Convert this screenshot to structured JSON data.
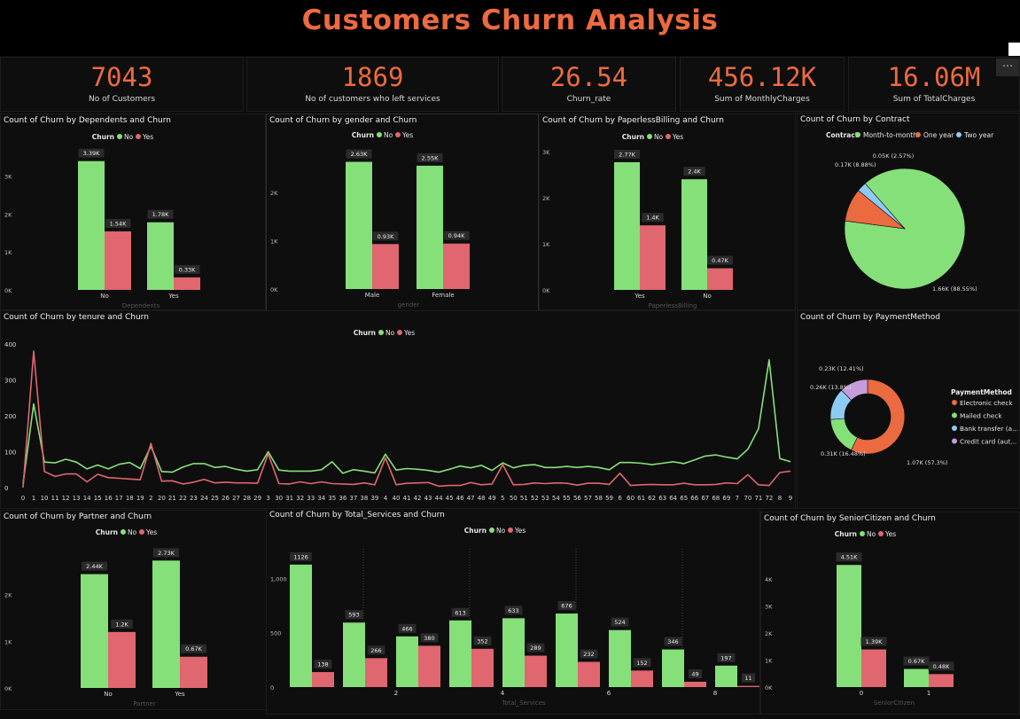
{
  "title": "Customers Churn Analysis",
  "colors": {
    "no": "#85e07a",
    "yes": "#e0666f",
    "accent": "#ec6a40",
    "one_year": "#ec6a40",
    "two_year": "#8ecbf3",
    "credit": "#c79cdb"
  },
  "kpis": [
    {
      "value": "7043",
      "label": "No of Customers"
    },
    {
      "value": "1869",
      "label": "No of customers who left services"
    },
    {
      "value": "26.54",
      "label": "Churn_rate"
    },
    {
      "value": "456.12K",
      "label": "Sum of MonthlyCharges"
    },
    {
      "value": "16.06M",
      "label": "Sum of TotalCharges"
    }
  ],
  "more_label": "⋯",
  "legend": {
    "title": "Churn",
    "no": "No",
    "yes": "Yes"
  },
  "chart_data": [
    {
      "id": "dependents",
      "type": "bar",
      "title": "Count of Churn by Dependents and Churn",
      "xlabel": "Dependents",
      "categories": [
        "No",
        "Yes"
      ],
      "series": [
        {
          "name": "No",
          "values": [
            3390,
            1780
          ],
          "labels": [
            "3.39K",
            "1.78K"
          ]
        },
        {
          "name": "Yes",
          "values": [
            1540,
            330
          ],
          "labels": [
            "1.54K",
            "0.33K"
          ]
        }
      ],
      "yticks": [
        {
          "v": 0,
          "t": "0K"
        },
        {
          "v": 1000,
          "t": "1K"
        },
        {
          "v": 2000,
          "t": "2K"
        },
        {
          "v": 3000,
          "t": "3K"
        }
      ],
      "ylim": [
        0,
        3500
      ]
    },
    {
      "id": "gender",
      "type": "bar",
      "title": "Count of Churn by gender and Churn",
      "xlabel": "gender",
      "categories": [
        "Male",
        "Female"
      ],
      "series": [
        {
          "name": "No",
          "values": [
            2630,
            2550
          ],
          "labels": [
            "2.63K",
            "2.55K"
          ]
        },
        {
          "name": "Yes",
          "values": [
            930,
            940
          ],
          "labels": [
            "0.93K",
            "0.94K"
          ]
        }
      ],
      "yticks": [
        {
          "v": 0,
          "t": "0K"
        },
        {
          "v": 1000,
          "t": "1K"
        },
        {
          "v": 2000,
          "t": "2K"
        }
      ],
      "ylim": [
        0,
        2750
      ]
    },
    {
      "id": "paperless",
      "type": "bar",
      "title": "Count of Churn by PaperlessBilling and Churn",
      "xlabel": "PaperlessBilling",
      "categories": [
        "Yes",
        "No"
      ],
      "series": [
        {
          "name": "No",
          "values": [
            2770,
            2400
          ],
          "labels": [
            "2.77K",
            "2.4K"
          ]
        },
        {
          "name": "Yes",
          "values": [
            1400,
            470
          ],
          "labels": [
            "1.4K",
            "0.47K"
          ]
        }
      ],
      "yticks": [
        {
          "v": 0,
          "t": "0K"
        },
        {
          "v": 1000,
          "t": "1K"
        },
        {
          "v": 2000,
          "t": "2K"
        },
        {
          "v": 3000,
          "t": "3K"
        }
      ],
      "ylim": [
        0,
        3000
      ]
    },
    {
      "id": "contract",
      "type": "pie",
      "title": "Count of Churn by Contract",
      "legend_title": "Contract",
      "slices": [
        {
          "name": "Month-to-month",
          "value": 1655,
          "label": "1.66K (88.55%)"
        },
        {
          "name": "One year",
          "value": 166,
          "label": "0.17K (8.88%)"
        },
        {
          "name": "Two year",
          "value": 48,
          "label": "0.05K (2.57%)"
        }
      ]
    },
    {
      "id": "tenure",
      "type": "line",
      "title": "Count of Churn by tenure and Churn",
      "xlabel": "tenure",
      "categories": [
        "0",
        "1",
        "10",
        "11",
        "12",
        "13",
        "14",
        "15",
        "16",
        "17",
        "18",
        "19",
        "2",
        "20",
        "21",
        "22",
        "23",
        "24",
        "25",
        "26",
        "27",
        "28",
        "29",
        "3",
        "30",
        "31",
        "32",
        "33",
        "34",
        "35",
        "36",
        "37",
        "38",
        "39",
        "4",
        "40",
        "41",
        "42",
        "43",
        "44",
        "45",
        "46",
        "47",
        "48",
        "49",
        "5",
        "50",
        "51",
        "52",
        "53",
        "54",
        "55",
        "56",
        "57",
        "58",
        "59",
        "6",
        "60",
        "61",
        "62",
        "63",
        "64",
        "65",
        "66",
        "67",
        "68",
        "69",
        "7",
        "70",
        "71",
        "72",
        "8",
        "9"
      ],
      "series": [
        {
          "name": "No",
          "values": [
            11,
            233,
            71,
            69,
            79,
            71,
            52,
            63,
            52,
            65,
            70,
            53,
            115,
            45,
            43,
            57,
            67,
            67,
            56,
            59,
            51,
            46,
            50,
            100,
            49,
            46,
            46,
            46,
            50,
            72,
            40,
            50,
            46,
            41,
            93,
            49,
            53,
            51,
            48,
            43,
            51,
            60,
            55,
            62,
            48,
            69,
            55,
            62,
            64,
            56,
            56,
            59,
            56,
            59,
            56,
            50,
            70,
            70,
            68,
            64,
            68,
            72,
            67,
            77,
            88,
            91,
            85,
            80,
            107,
            164,
            356,
            81,
            72
          ]
        },
        {
          "name": "Yes",
          "values": [
            0,
            380,
            45,
            31,
            38,
            38,
            16,
            37,
            28,
            26,
            24,
            22,
            123,
            18,
            19,
            10,
            15,
            23,
            13,
            15,
            13,
            13,
            12,
            94,
            11,
            10,
            16,
            11,
            16,
            11,
            10,
            9,
            13,
            8,
            83,
            8,
            12,
            13,
            14,
            4,
            6,
            6,
            14,
            8,
            10,
            64,
            8,
            9,
            13,
            11,
            13,
            12,
            7,
            12,
            12,
            9,
            40,
            6,
            8,
            9,
            8,
            8,
            12,
            8,
            8,
            9,
            13,
            11,
            36,
            8,
            6,
            42,
            46
          ]
        }
      ],
      "yticks": [
        {
          "v": 0,
          "t": "0"
        },
        {
          "v": 100,
          "t": "100"
        },
        {
          "v": 200,
          "t": "200"
        },
        {
          "v": 300,
          "t": "300"
        },
        {
          "v": 400,
          "t": "400"
        }
      ],
      "ylim": [
        0,
        400
      ]
    },
    {
      "id": "payment",
      "type": "pie",
      "title": "Count of Churn by PaymentMethod",
      "legend_title": "PaymentMethod",
      "slices": [
        {
          "name": "Electronic check",
          "value": 1071,
          "label": "1.07K (57.3%)"
        },
        {
          "name": "Mailed check",
          "value": 308,
          "label": "0.31K (16.48%)"
        },
        {
          "name": "Bank transfer (a...",
          "value": 258,
          "label": "0.26K (13.8%)"
        },
        {
          "name": "Credit card (aut...",
          "value": 232,
          "label": "0.23K (12.41%)"
        }
      ]
    },
    {
      "id": "partner",
      "type": "bar",
      "title": "Count of Churn by Partner and Churn",
      "xlabel": "Partner",
      "categories": [
        "No",
        "Yes"
      ],
      "series": [
        {
          "name": "No",
          "values": [
            2440,
            2730
          ],
          "labels": [
            "2.44K",
            "2.73K"
          ]
        },
        {
          "name": "Yes",
          "values": [
            1200,
            670
          ],
          "labels": [
            "1.2K",
            "0.67K"
          ]
        }
      ],
      "yticks": [
        {
          "v": 0,
          "t": "0K"
        },
        {
          "v": 1000,
          "t": "1K"
        },
        {
          "v": 2000,
          "t": "2K"
        }
      ],
      "ylim": [
        0,
        2850
      ]
    },
    {
      "id": "services",
      "type": "bar",
      "title": "Count of Churn by Total_Services and Churn",
      "xlabel": "Total_Services",
      "categories": [
        "1",
        "2",
        "3",
        "4",
        "5",
        "6",
        "7",
        "8",
        "9"
      ],
      "xticks": [
        "",
        "2",
        "",
        "4",
        "",
        "6",
        "",
        "8",
        ""
      ],
      "series": [
        {
          "name": "No",
          "values": [
            1126,
            593,
            466,
            613,
            633,
            676,
            524,
            346,
            197
          ],
          "labels": [
            "1126",
            "593",
            "466",
            "613",
            "633",
            "676",
            "524",
            "346",
            "197"
          ]
        },
        {
          "name": "Yes",
          "values": [
            138,
            266,
            380,
            352,
            289,
            232,
            152,
            49,
            11
          ],
          "labels": [
            "138",
            "266",
            "380",
            "352",
            "289",
            "232",
            "152",
            "49",
            "11"
          ]
        }
      ],
      "yticks": [
        {
          "v": 0,
          "t": "0"
        },
        {
          "v": 500,
          "t": "500"
        },
        {
          "v": 1000,
          "t": "1,000"
        }
      ],
      "ylim": [
        0,
        1190
      ]
    },
    {
      "id": "senior",
      "type": "bar",
      "title": "Count of Churn by SeniorCitizen and Churn",
      "xlabel": "SeniorCitizen",
      "categories": [
        "0",
        "1"
      ],
      "series": [
        {
          "name": "No",
          "values": [
            4510,
            670
          ],
          "labels": [
            "4.51K",
            "0.67K"
          ]
        },
        {
          "name": "Yes",
          "values": [
            1390,
            480
          ],
          "labels": [
            "1.39K",
            "0.48K"
          ]
        }
      ],
      "yticks": [
        {
          "v": 0,
          "t": "0K"
        },
        {
          "v": 1000,
          "t": "1K"
        },
        {
          "v": 2000,
          "t": "2K"
        },
        {
          "v": 3000,
          "t": "3K"
        },
        {
          "v": 4000,
          "t": "4K"
        }
      ],
      "ylim": [
        0,
        4780
      ]
    }
  ]
}
